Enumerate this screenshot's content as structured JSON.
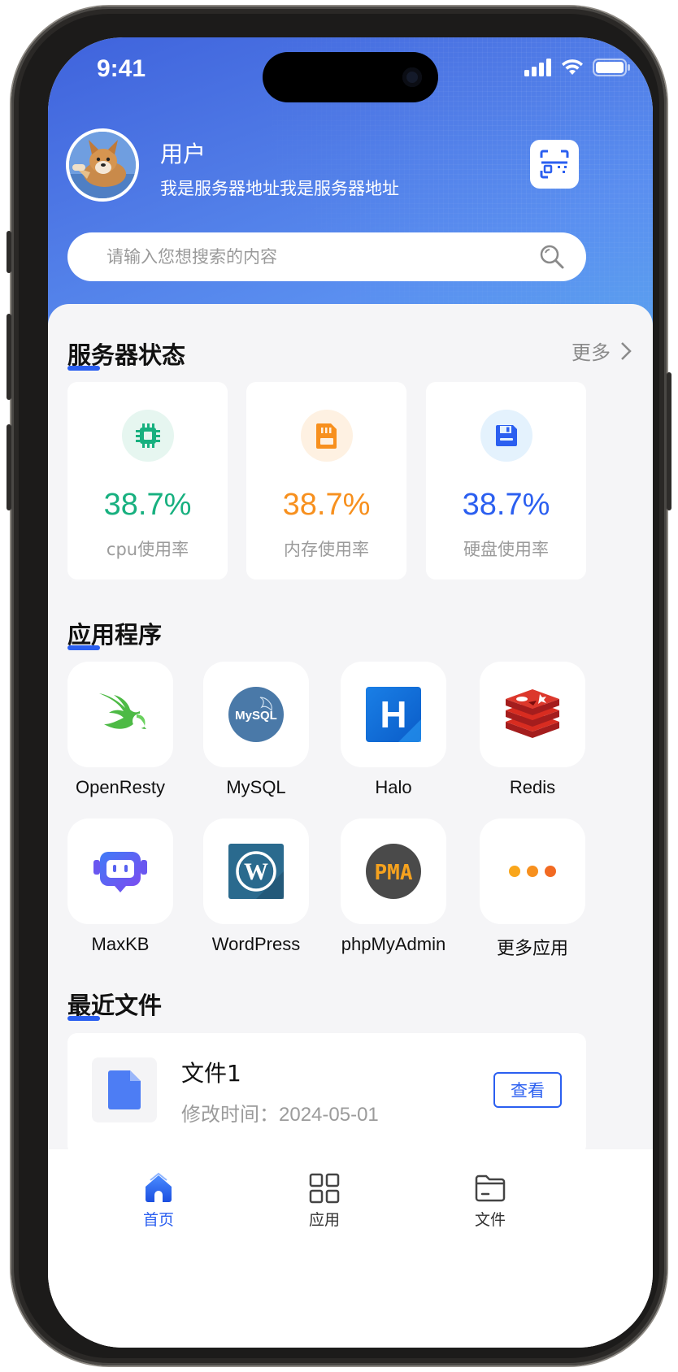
{
  "status_bar": {
    "time": "9:41"
  },
  "profile": {
    "name": "用户",
    "address": "我是服务器地址我是服务器地址"
  },
  "search": {
    "placeholder": "请输入您想搜索的内容"
  },
  "server_status": {
    "title": "服务器状态",
    "more_label": "更多",
    "cards": [
      {
        "value": "38.7%",
        "label": "cpu使用率",
        "color": "#17b07f",
        "bg": "#e6f6f0",
        "icon": "cpu-icon"
      },
      {
        "value": "38.7%",
        "label": "内存使用率",
        "color": "#f7901e",
        "bg": "#fef1e2",
        "icon": "memory-card-icon"
      },
      {
        "value": "38.7%",
        "label": "硬盘使用率",
        "color": "#2b5ff0",
        "bg": "#e4f2fd",
        "icon": "disk-save-icon"
      }
    ]
  },
  "apps": {
    "title": "应用程序",
    "items": [
      {
        "label": "OpenResty",
        "icon": "openresty-icon"
      },
      {
        "label": "MySQL",
        "icon": "mysql-icon"
      },
      {
        "label": "Halo",
        "icon": "halo-icon"
      },
      {
        "label": "Redis",
        "icon": "redis-icon"
      },
      {
        "label": "MaxKB",
        "icon": "maxkb-icon"
      },
      {
        "label": "WordPress",
        "icon": "wordpress-icon"
      },
      {
        "label": "phpMyAdmin",
        "icon": "phpmyadmin-icon"
      },
      {
        "label": "更多应用",
        "icon": "more-dots-icon"
      }
    ],
    "mysql_logo_text": "MySQL",
    "halo_logo_text": "H",
    "wordpress_logo_text": "W",
    "pma_logo_text": "PMA"
  },
  "recent_files": {
    "title": "最近文件",
    "items": [
      {
        "name": "文件1",
        "modified": "修改时间：2024-05-01",
        "action": "查看"
      }
    ]
  },
  "tabbar": {
    "items": [
      {
        "label": "首页",
        "icon": "home-icon",
        "active": true
      },
      {
        "label": "应用",
        "icon": "apps-grid-icon",
        "active": false
      },
      {
        "label": "文件",
        "icon": "folder-icon",
        "active": false
      }
    ]
  },
  "colors": {
    "accent": "#2b5ff0",
    "header_gradient_start": "#3f63dc",
    "header_gradient_end": "#5ba6ee"
  }
}
